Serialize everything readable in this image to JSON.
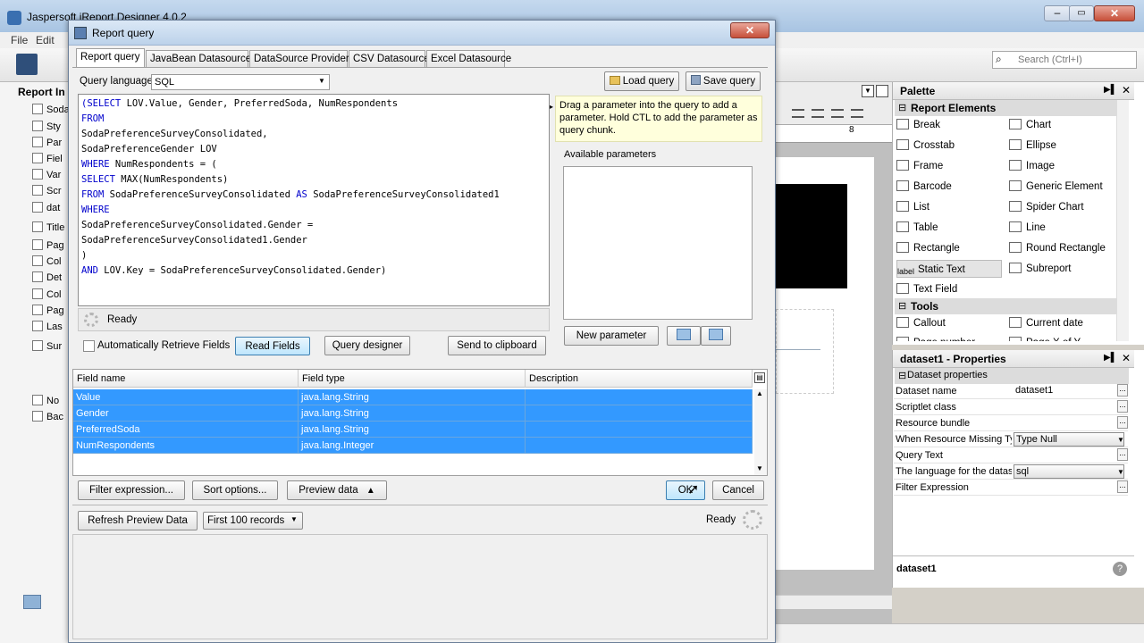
{
  "app": {
    "title": "Jaspersoft iReport Designer 4.0.2",
    "menu": [
      "File",
      "Edit"
    ],
    "search_placeholder": "Search (Ctrl+I)"
  },
  "left_panel": {
    "header": "Report In",
    "items": [
      "SodaPr",
      "Sty",
      "Par",
      "Fiel",
      "Var",
      "Scr",
      "dat",
      "Title",
      "Pag",
      "Col",
      "Det",
      "Col",
      "Pag",
      "Las",
      "Sur",
      "No",
      "Bac"
    ]
  },
  "palette": {
    "title": "Palette",
    "section_elements": "Report Elements",
    "elements_left": [
      "Break",
      "Crosstab",
      "Frame",
      "Barcode",
      "List",
      "Table",
      "Rectangle",
      "Static Text",
      "Text Field"
    ],
    "elements_right": [
      "Chart",
      "Ellipse",
      "Image",
      "Generic Element",
      "Spider Chart",
      "Line",
      "Round Rectangle",
      "Subreport"
    ],
    "section_tools": "Tools",
    "tools_left": [
      "Callout",
      "Page number"
    ],
    "tools_right": [
      "Current date",
      "Page X of Y"
    ],
    "static_text_icon": "label"
  },
  "properties": {
    "title": "dataset1 - Properties",
    "section": "Dataset properties",
    "rows": [
      {
        "name": "Dataset name",
        "value": "dataset1"
      },
      {
        "name": "Scriptlet class",
        "value": ""
      },
      {
        "name": "Resource bundle",
        "value": ""
      },
      {
        "name": "When Resource Missing Ty",
        "value": "Type Null"
      },
      {
        "name": "Query Text",
        "value": ""
      },
      {
        "name": "The language for the datas",
        "value": "sql"
      },
      {
        "name": "Filter Expression",
        "value": ""
      }
    ],
    "footer": "dataset1"
  },
  "ruler": {
    "mark": "8"
  },
  "dialog": {
    "title": "Report query",
    "tabs": [
      "Report query",
      "JavaBean Datasource",
      "DataSource Provider",
      "CSV Datasource",
      "Excel Datasource"
    ],
    "language_label": "Query language",
    "language_value": "SQL",
    "load_query": "Load query",
    "save_query": "Save query",
    "sql": [
      [
        {
          "k": "(SELECT",
          "kw": true
        },
        {
          "k": " LOV.Value, Gender, PreferredSoda, NumRespondents",
          "kw": false
        }
      ],
      [
        {
          "k": "FROM",
          "kw": true
        }
      ],
      [
        {
          "k": "SodaPreferenceSurveyConsolidated,",
          "kw": false
        }
      ],
      [
        {
          "k": "SodaPreferenceGender LOV",
          "kw": false
        }
      ],
      [
        {
          "k": "WHERE",
          "kw": true
        },
        {
          "k": " NumRespondents = (",
          "kw": false
        }
      ],
      [
        {
          "k": "SELECT",
          "kw": true
        },
        {
          "k": " MAX(NumRespondents)",
          "kw": false
        }
      ],
      [
        {
          "k": "FROM",
          "kw": true
        },
        {
          "k": " SodaPreferenceSurveyConsolidated ",
          "kw": false
        },
        {
          "k": "AS",
          "kw": true
        },
        {
          "k": " SodaPreferenceSurveyConsolidated1",
          "kw": false
        }
      ],
      [
        {
          "k": "WHERE",
          "kw": true
        }
      ],
      [
        {
          "k": "SodaPreferenceSurveyConsolidated.Gender =",
          "kw": false
        }
      ],
      [
        {
          "k": "SodaPreferenceSurveyConsolidated1.Gender",
          "kw": false
        }
      ],
      [
        {
          "k": ")",
          "kw": false
        }
      ],
      [
        {
          "k": "AND",
          "kw": true
        },
        {
          "k": " LOV.Key = SodaPreferenceSurveyConsolidated.Gender)",
          "kw": false
        }
      ]
    ],
    "status": "Ready",
    "hint": "Drag a parameter into the query to add a parameter. Hold CTL to add the parameter as query chunk.",
    "available_parameters": "Available parameters",
    "new_parameter": "New parameter",
    "auto_retrieve": "Automatically Retrieve Fields",
    "read_fields": "Read Fields",
    "query_designer": "Query designer",
    "send_clipboard": "Send to clipboard",
    "columns": [
      "Field name",
      "Field type",
      "Description"
    ],
    "fields": [
      {
        "name": "Value",
        "type": "java.lang.String",
        "desc": ""
      },
      {
        "name": "Gender",
        "type": "java.lang.String",
        "desc": ""
      },
      {
        "name": "PreferredSoda",
        "type": "java.lang.String",
        "desc": ""
      },
      {
        "name": "NumRespondents",
        "type": "java.lang.Integer",
        "desc": ""
      }
    ],
    "filter_expression": "Filter expression...",
    "sort_options": "Sort options...",
    "preview_data": "Preview data",
    "ok": "OK",
    "cancel": "Cancel",
    "refresh_preview": "Refresh Preview Data",
    "records": "First 100 records",
    "preview_status": "Ready"
  }
}
